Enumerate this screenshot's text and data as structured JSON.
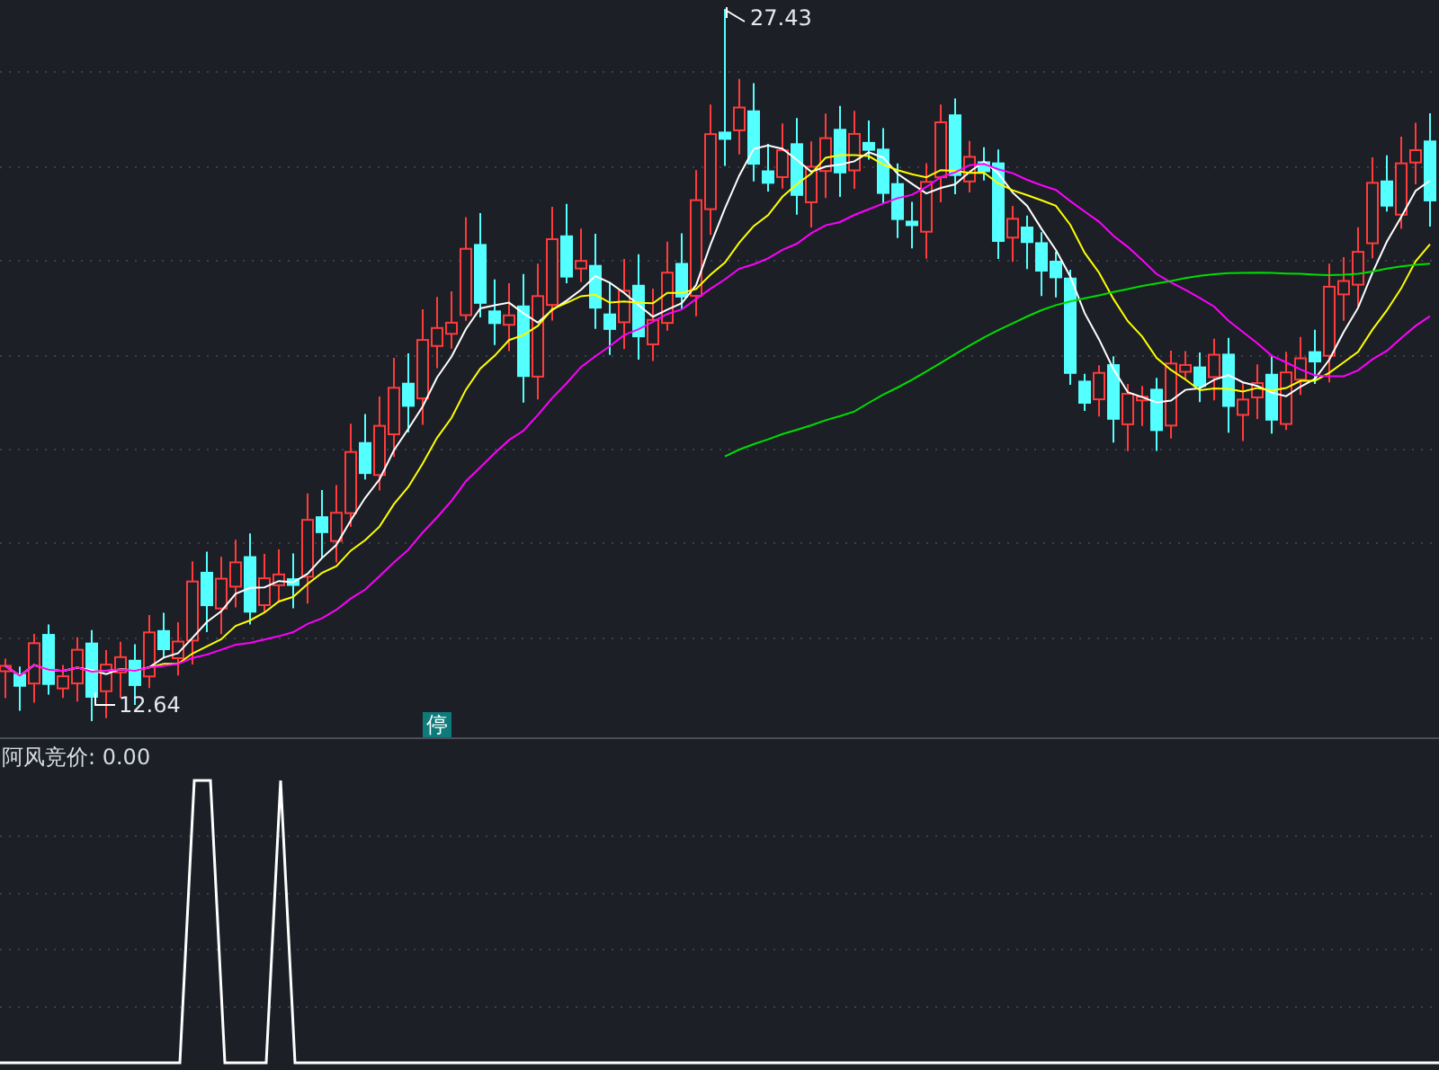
{
  "price_chart": {
    "high_label": "27.43",
    "low_label": "12.64",
    "badge": "停"
  },
  "indicator": {
    "label": "阿风竞价: 0.00"
  }
}
